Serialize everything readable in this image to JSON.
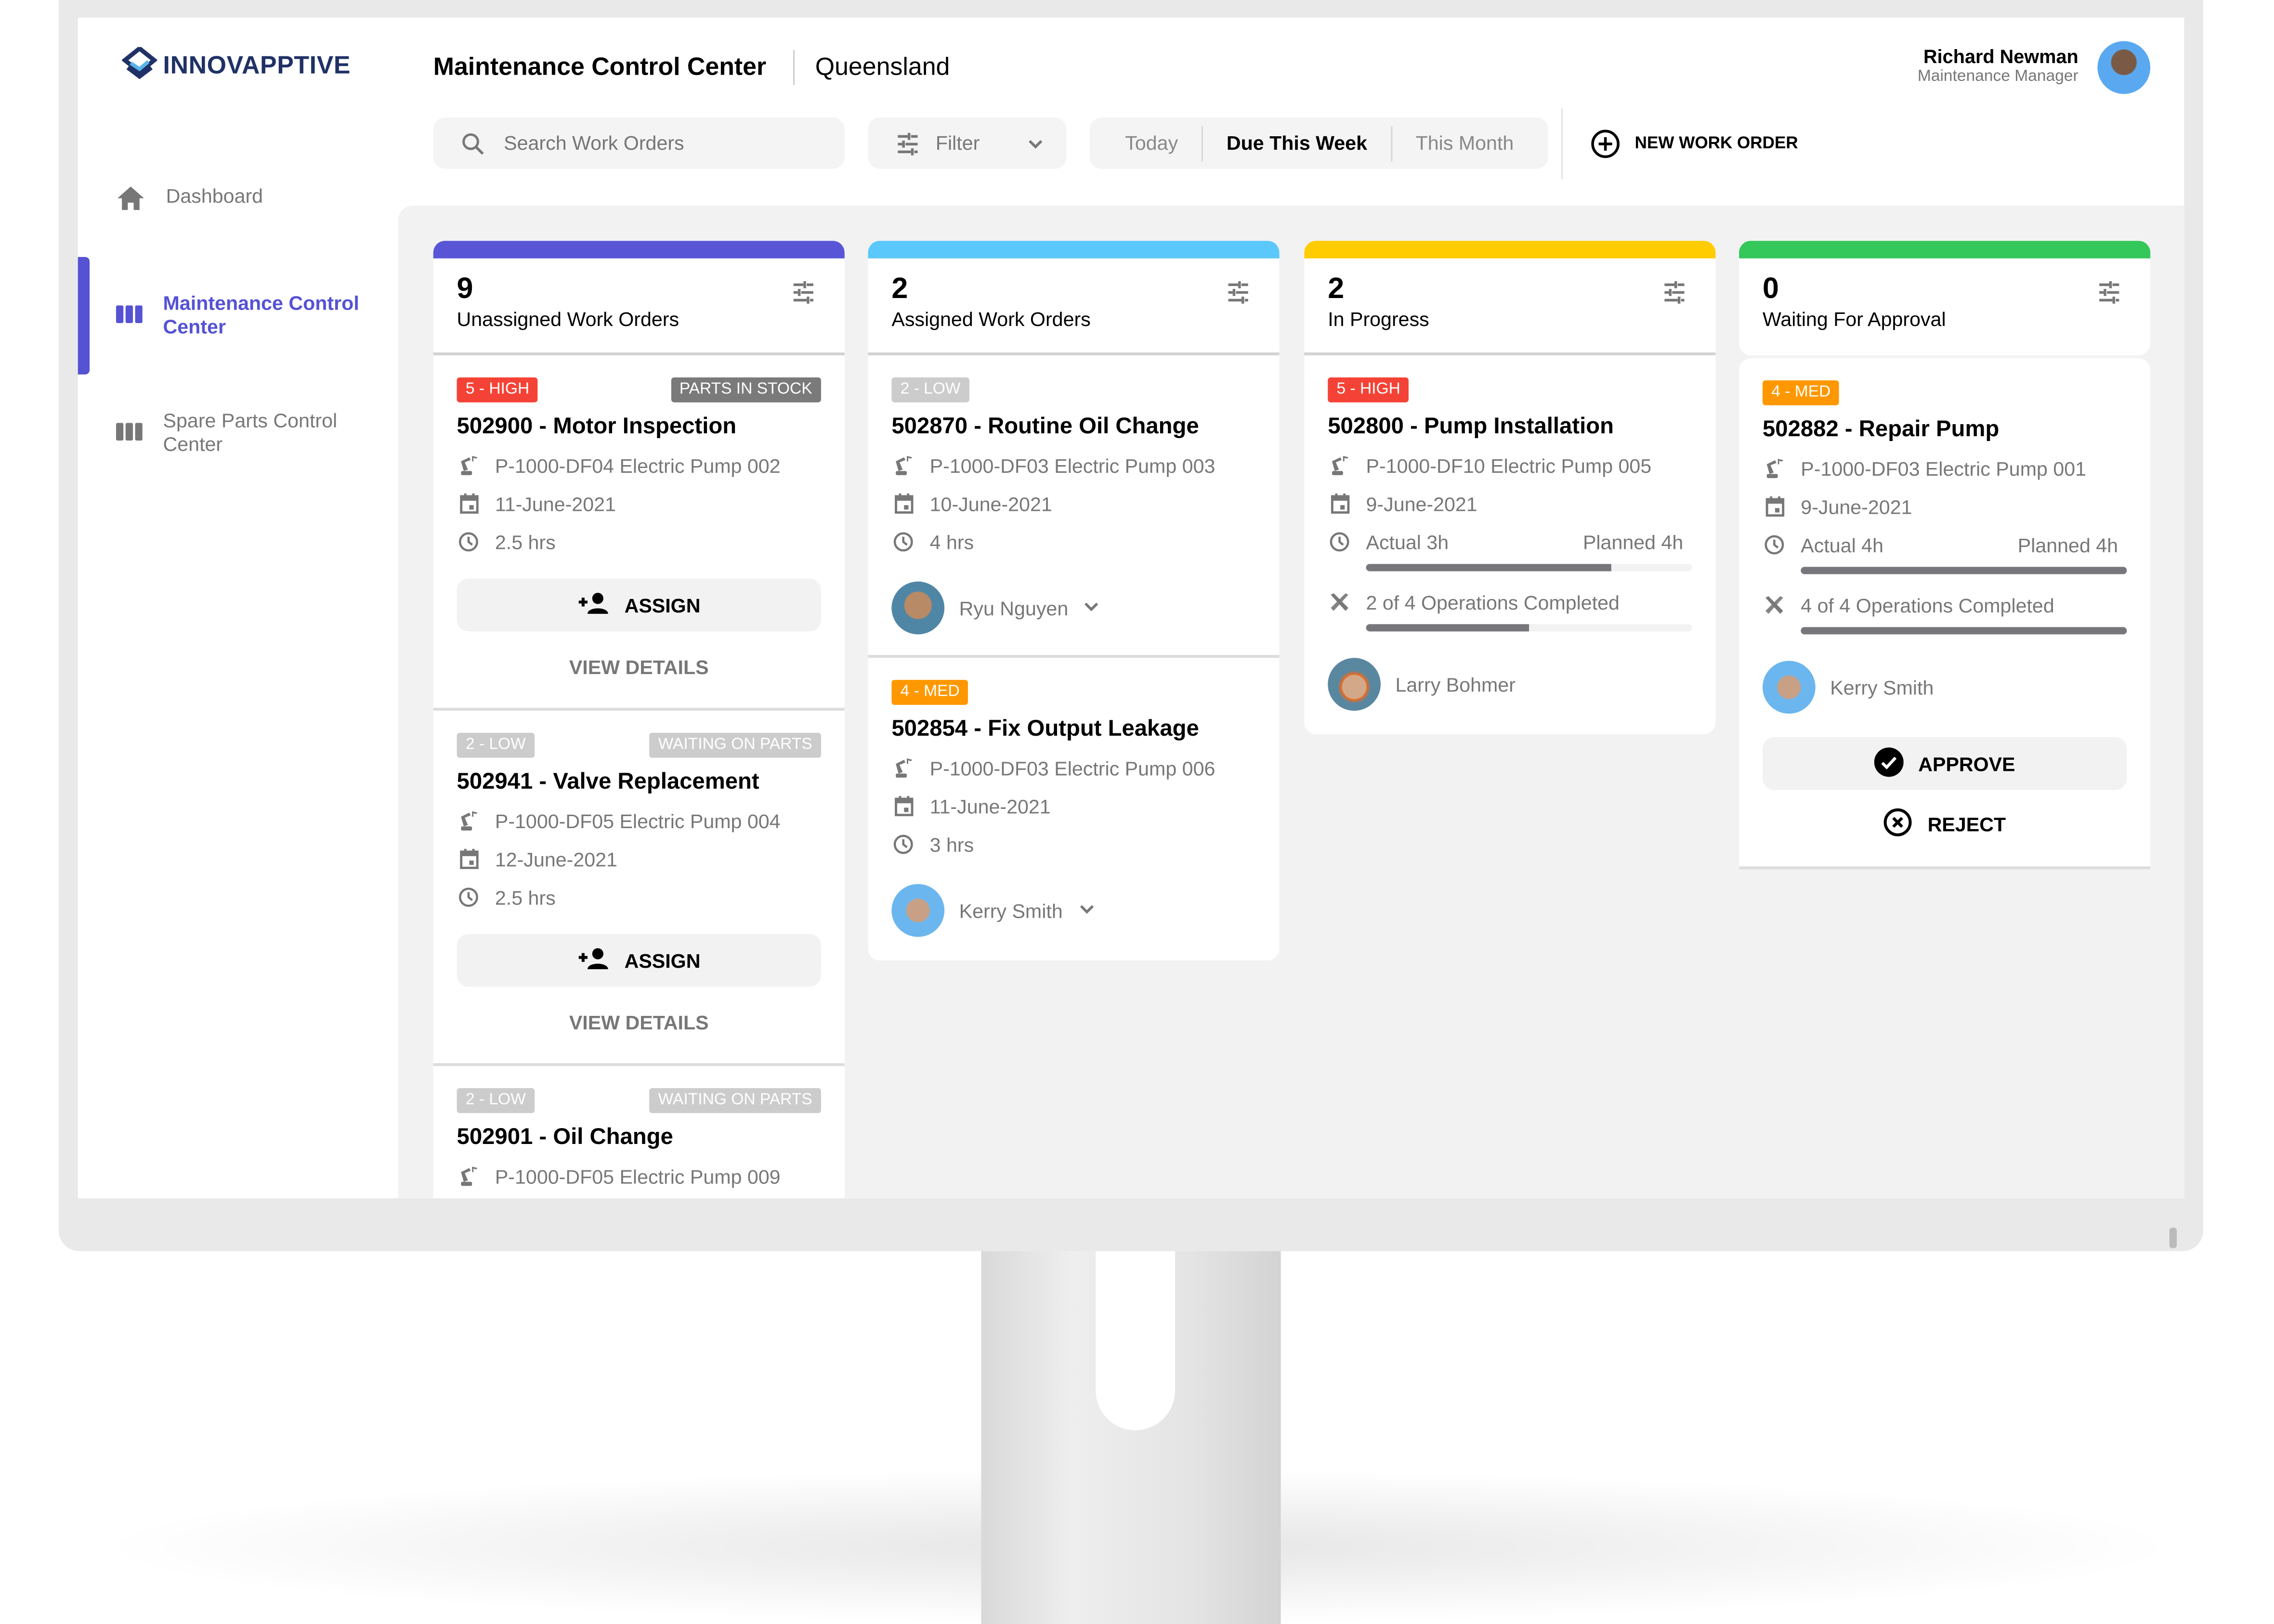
{
  "app": {
    "logo_text": "INNOVAPPTIVE",
    "title": "Maintenance Control Center",
    "region": "Queensland"
  },
  "user": {
    "name": "Richard Newman",
    "role": "Maintenance Manager"
  },
  "toolbar": {
    "search_placeholder": "Search Work Orders",
    "filter_label": "Filter",
    "ranges": [
      "Today",
      "Due This Week",
      "This Month"
    ],
    "active_range": "Due This Week",
    "new_work_order": "NEW WORK ORDER"
  },
  "sidebar": {
    "items": [
      {
        "label": "Dashboard",
        "icon": "home-icon",
        "active": false
      },
      {
        "label": "Maintenance Control Center",
        "icon": "columns-icon",
        "active": true
      },
      {
        "label": "Spare Parts Control Center",
        "icon": "columns-icon",
        "active": false
      }
    ]
  },
  "colors": {
    "accent": "#5552d4",
    "high": "#f44336",
    "med": "#ff9800",
    "low": "#cccccc",
    "unassigned": "#5856d6",
    "assigned": "#5ac8fa",
    "in_progress": "#ffcc00",
    "approval": "#34c759"
  },
  "columns": [
    {
      "count": "9",
      "label": "Unassigned Work Orders",
      "color": "#5856d6",
      "cards": [
        {
          "priority": "5 - HIGH",
          "priority_color": "#f44336",
          "status": "PARTS IN STOCK",
          "status_color": "#7a7a7a",
          "title": "502900 - Motor Inspection",
          "equipment": "P-1000-DF04 Electric Pump 002",
          "date": "11-June-2021",
          "duration": "2.5 hrs",
          "assign": "ASSIGN",
          "view": "VIEW DETAILS"
        },
        {
          "priority": "2 - LOW",
          "priority_color": "#cccccc",
          "status": "WAITING ON PARTS",
          "status_color": "#cccccc",
          "title": "502941 - Valve Replacement",
          "equipment": "P-1000-DF05 Electric Pump 004",
          "date": "12-June-2021",
          "duration": "2.5 hrs",
          "assign": "ASSIGN",
          "view": "VIEW DETAILS"
        },
        {
          "priority": "2 - LOW",
          "priority_color": "#cccccc",
          "status": "WAITING ON PARTS",
          "status_color": "#cccccc",
          "title": "502901 - Oil Change",
          "equipment": "P-1000-DF05 Electric Pump 009"
        }
      ]
    },
    {
      "count": "2",
      "label": "Assigned Work Orders",
      "color": "#5ac8fa",
      "cards": [
        {
          "priority": "2 - LOW",
          "priority_color": "#cccccc",
          "title": "502870 - Routine Oil Change",
          "equipment": "P-1000-DF03 Electric Pump 003",
          "date": "10-June-2021",
          "duration": "4 hrs",
          "assignee": "Ryu Nguyen"
        },
        {
          "priority": "4 - MED",
          "priority_color": "#ff9800",
          "title": "502854 - Fix Output Leakage",
          "equipment": "P-1000-DF03 Electric Pump 006",
          "date": "11-June-2021",
          "duration": "3 hrs",
          "assignee": "Kerry Smith"
        }
      ]
    },
    {
      "count": "2",
      "label": "In Progress",
      "color": "#ffcc00",
      "cards": [
        {
          "priority": "5 - HIGH",
          "priority_color": "#f44336",
          "title": "502800 - Pump Installation",
          "equipment": "P-1000-DF10 Electric Pump 005",
          "date": "9-June-2021",
          "actual": "Actual 3h",
          "planned": "Planned 4h",
          "hours_progress": 0.75,
          "operations": "2 of 4 Operations Completed",
          "ops_progress": 0.5,
          "assignee": "Larry Bohmer"
        }
      ]
    },
    {
      "count": "0",
      "label": "Waiting For Approval",
      "color": "#34c759",
      "cards": [
        {
          "priority": "4 - MED",
          "priority_color": "#ff9800",
          "title": "502882 - Repair Pump",
          "equipment": "P-1000-DF03 Electric Pump 001",
          "date": "9-June-2021",
          "actual": "Actual 4h",
          "planned": "Planned 4h",
          "hours_progress": 1.0,
          "operations": "4 of 4 Operations Completed",
          "ops_progress": 1.0,
          "assignee": "Kerry Smith",
          "approve": "APPROVE",
          "reject": "REJECT"
        }
      ]
    }
  ]
}
